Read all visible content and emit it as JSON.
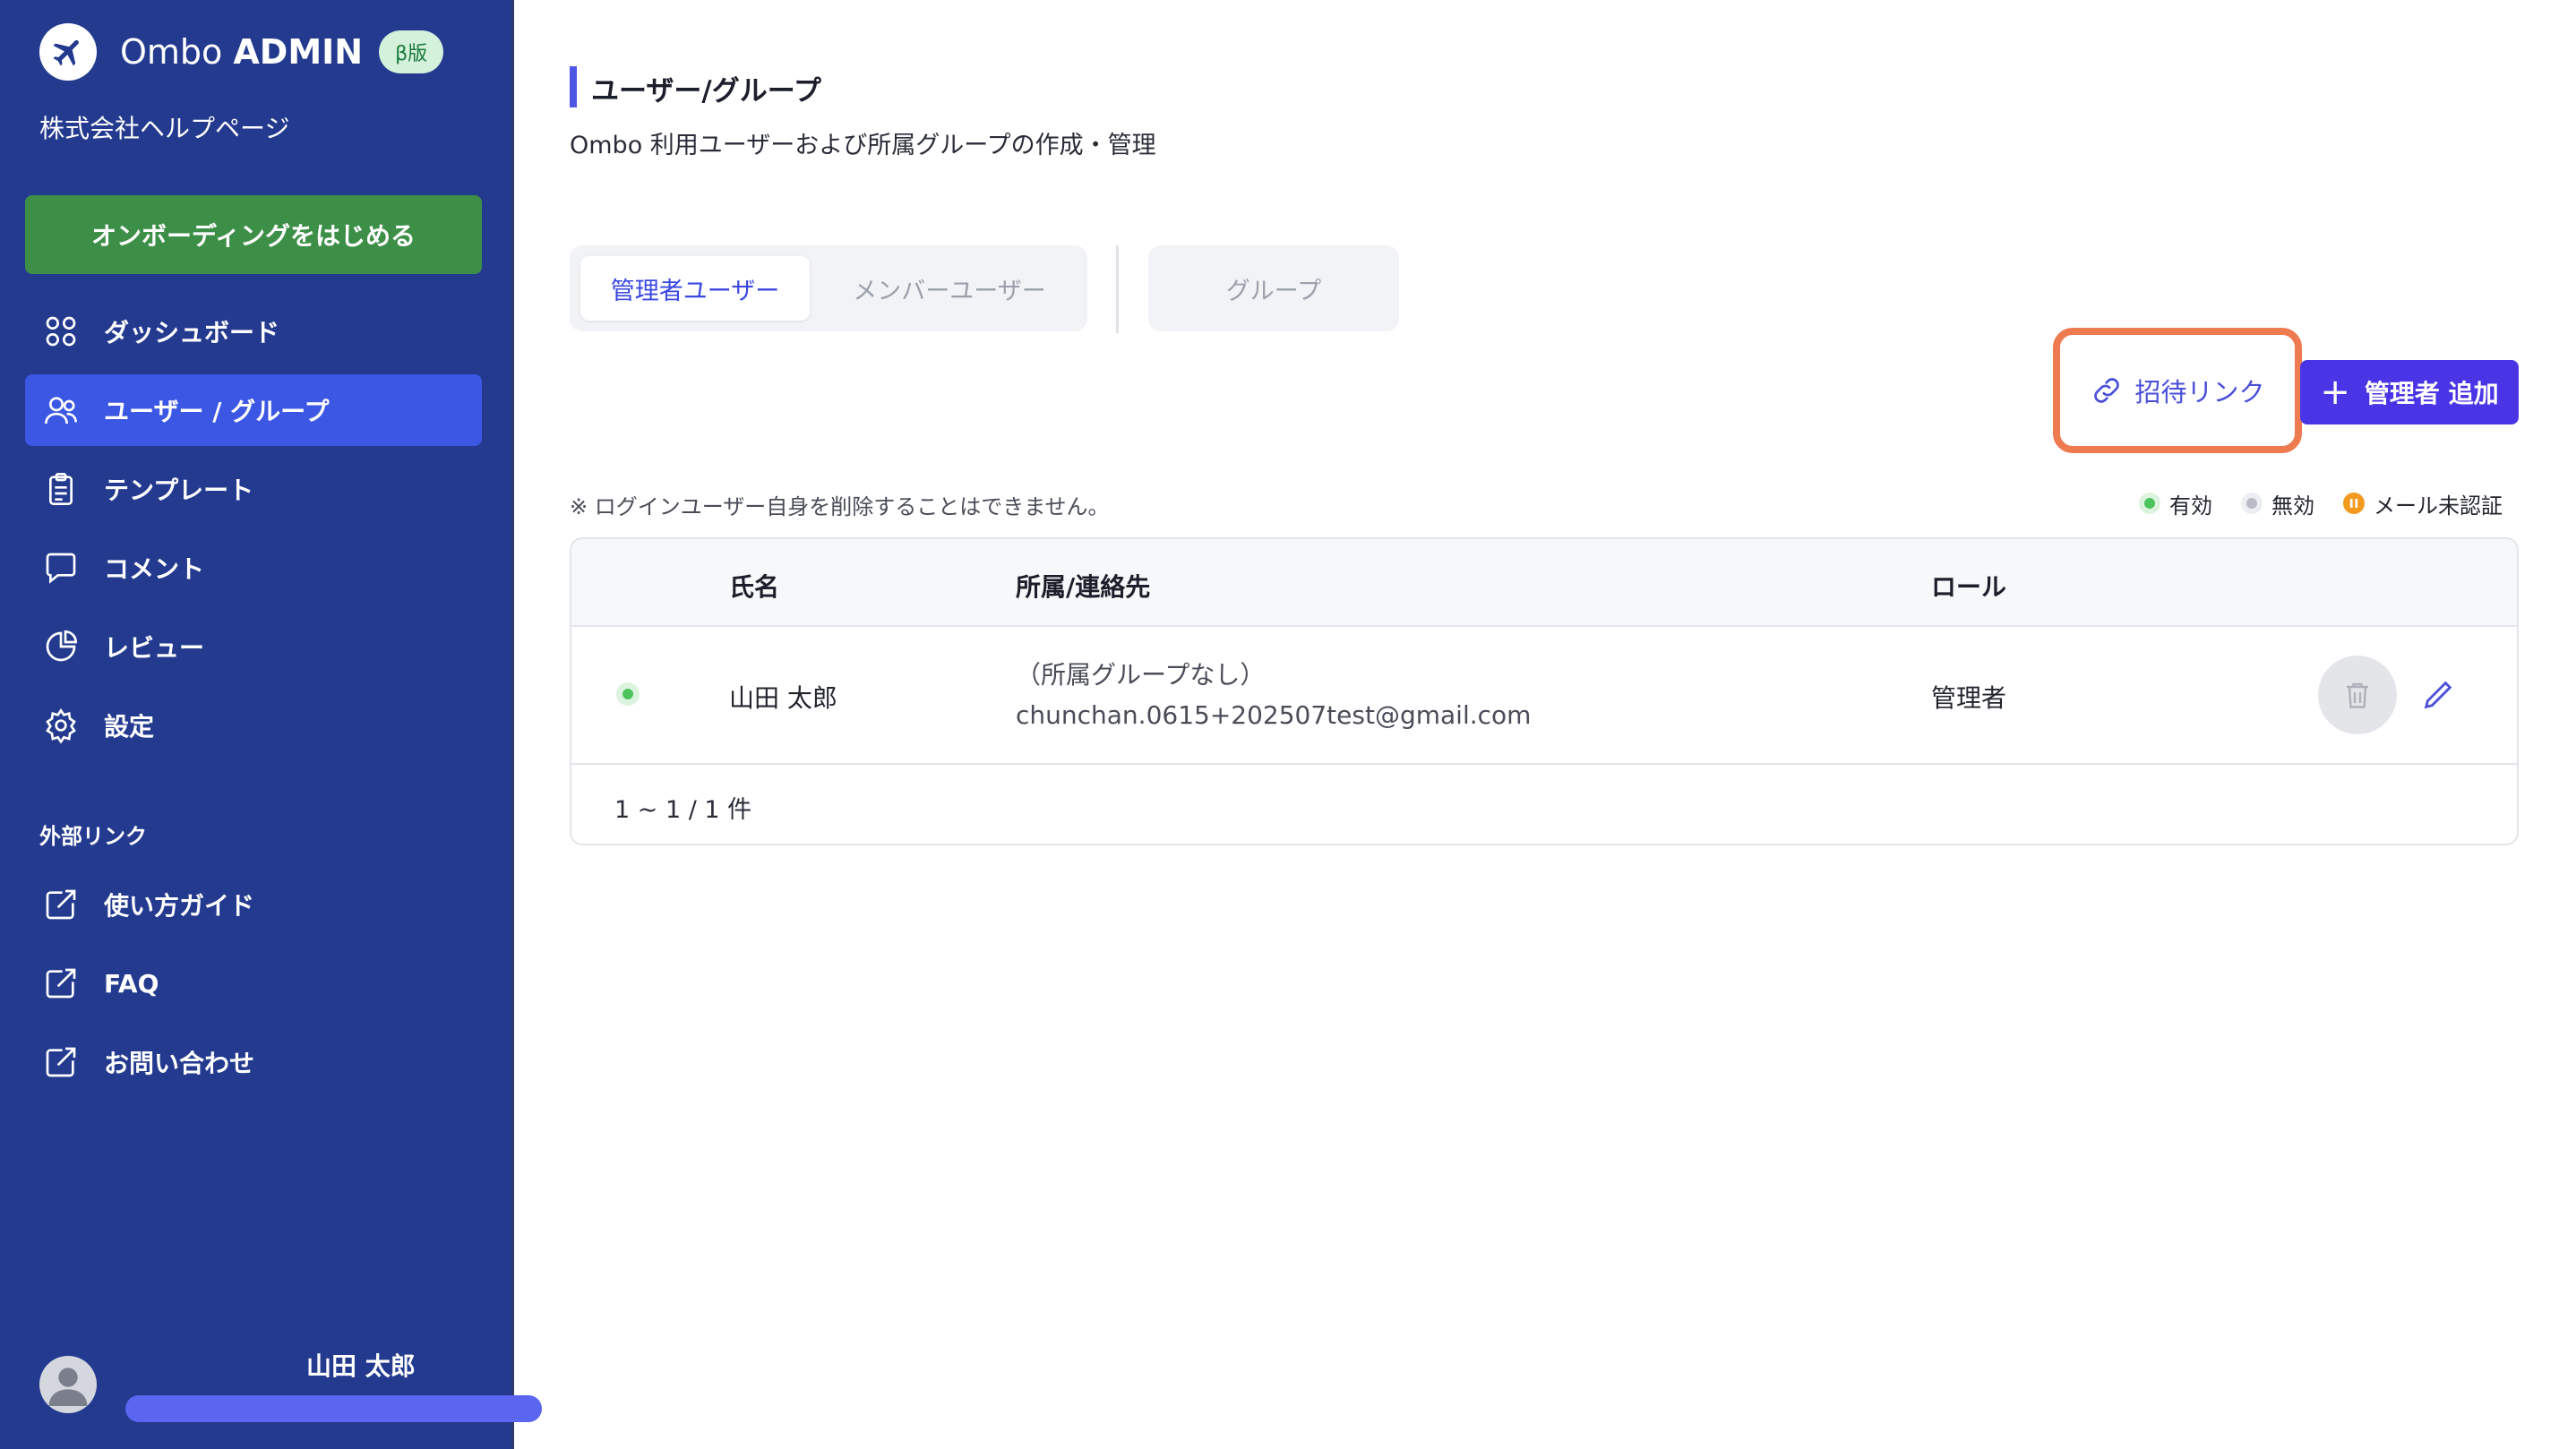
{
  "app": {
    "brand_name": "Ombo",
    "brand_suffix": "ADMIN",
    "beta_badge": "β版",
    "company": "株式会社ヘルプページ"
  },
  "sidebar": {
    "onboarding_button": "オンボーディングをはじめる",
    "items": [
      {
        "label": "ダッシュボード",
        "icon": "grid-icon"
      },
      {
        "label": "ユーザー / グループ",
        "icon": "users-icon",
        "active": true
      },
      {
        "label": "テンプレート",
        "icon": "clipboard-icon"
      },
      {
        "label": "コメント",
        "icon": "comment-icon"
      },
      {
        "label": "レビュー",
        "icon": "pie-chart-icon"
      },
      {
        "label": "設定",
        "icon": "gear-icon"
      }
    ],
    "external_section_label": "外部リンク",
    "external_items": [
      {
        "label": "使い方ガイド",
        "icon": "external-link-icon"
      },
      {
        "label": "FAQ",
        "icon": "external-link-icon"
      },
      {
        "label": "お問い合わせ",
        "icon": "external-link-icon"
      }
    ],
    "user_name": "山田 太郎"
  },
  "main": {
    "title": "ユーザー/グループ",
    "subtitle": "Ombo 利用ユーザーおよび所属グループの作成・管理",
    "tabs": [
      {
        "label": "管理者ユーザー",
        "active": true
      },
      {
        "label": "メンバーユーザー",
        "active": false
      }
    ],
    "group_tab": "グループ",
    "invite_button": "招待リンク",
    "add_button": "管理者 追加",
    "notice": "※ ログインユーザー自身を削除することはできません。",
    "legend": {
      "active": "有効",
      "inactive": "無効",
      "unverified": "メール未認証"
    },
    "table": {
      "columns": [
        "氏名",
        "所属/連絡先",
        "ロール"
      ],
      "rows": [
        {
          "status": "active",
          "name": "山田 太郎",
          "group": "（所属グループなし）",
          "email": "chunchan.0615+202507test@gmail.com",
          "role": "管理者"
        }
      ],
      "pagination": "1 ~ 1 / 1 件"
    }
  },
  "colors": {
    "sidebar_bg": "#233a8f",
    "nav_active": "#3b57e3",
    "onboarding_green": "#3d8f47",
    "accent_purple": "#4a35e6",
    "highlight_orange": "#ee7a50",
    "status_active": "#4cc45d",
    "status_inactive": "#b9bcc6",
    "status_unverified": "#f29a1f"
  }
}
